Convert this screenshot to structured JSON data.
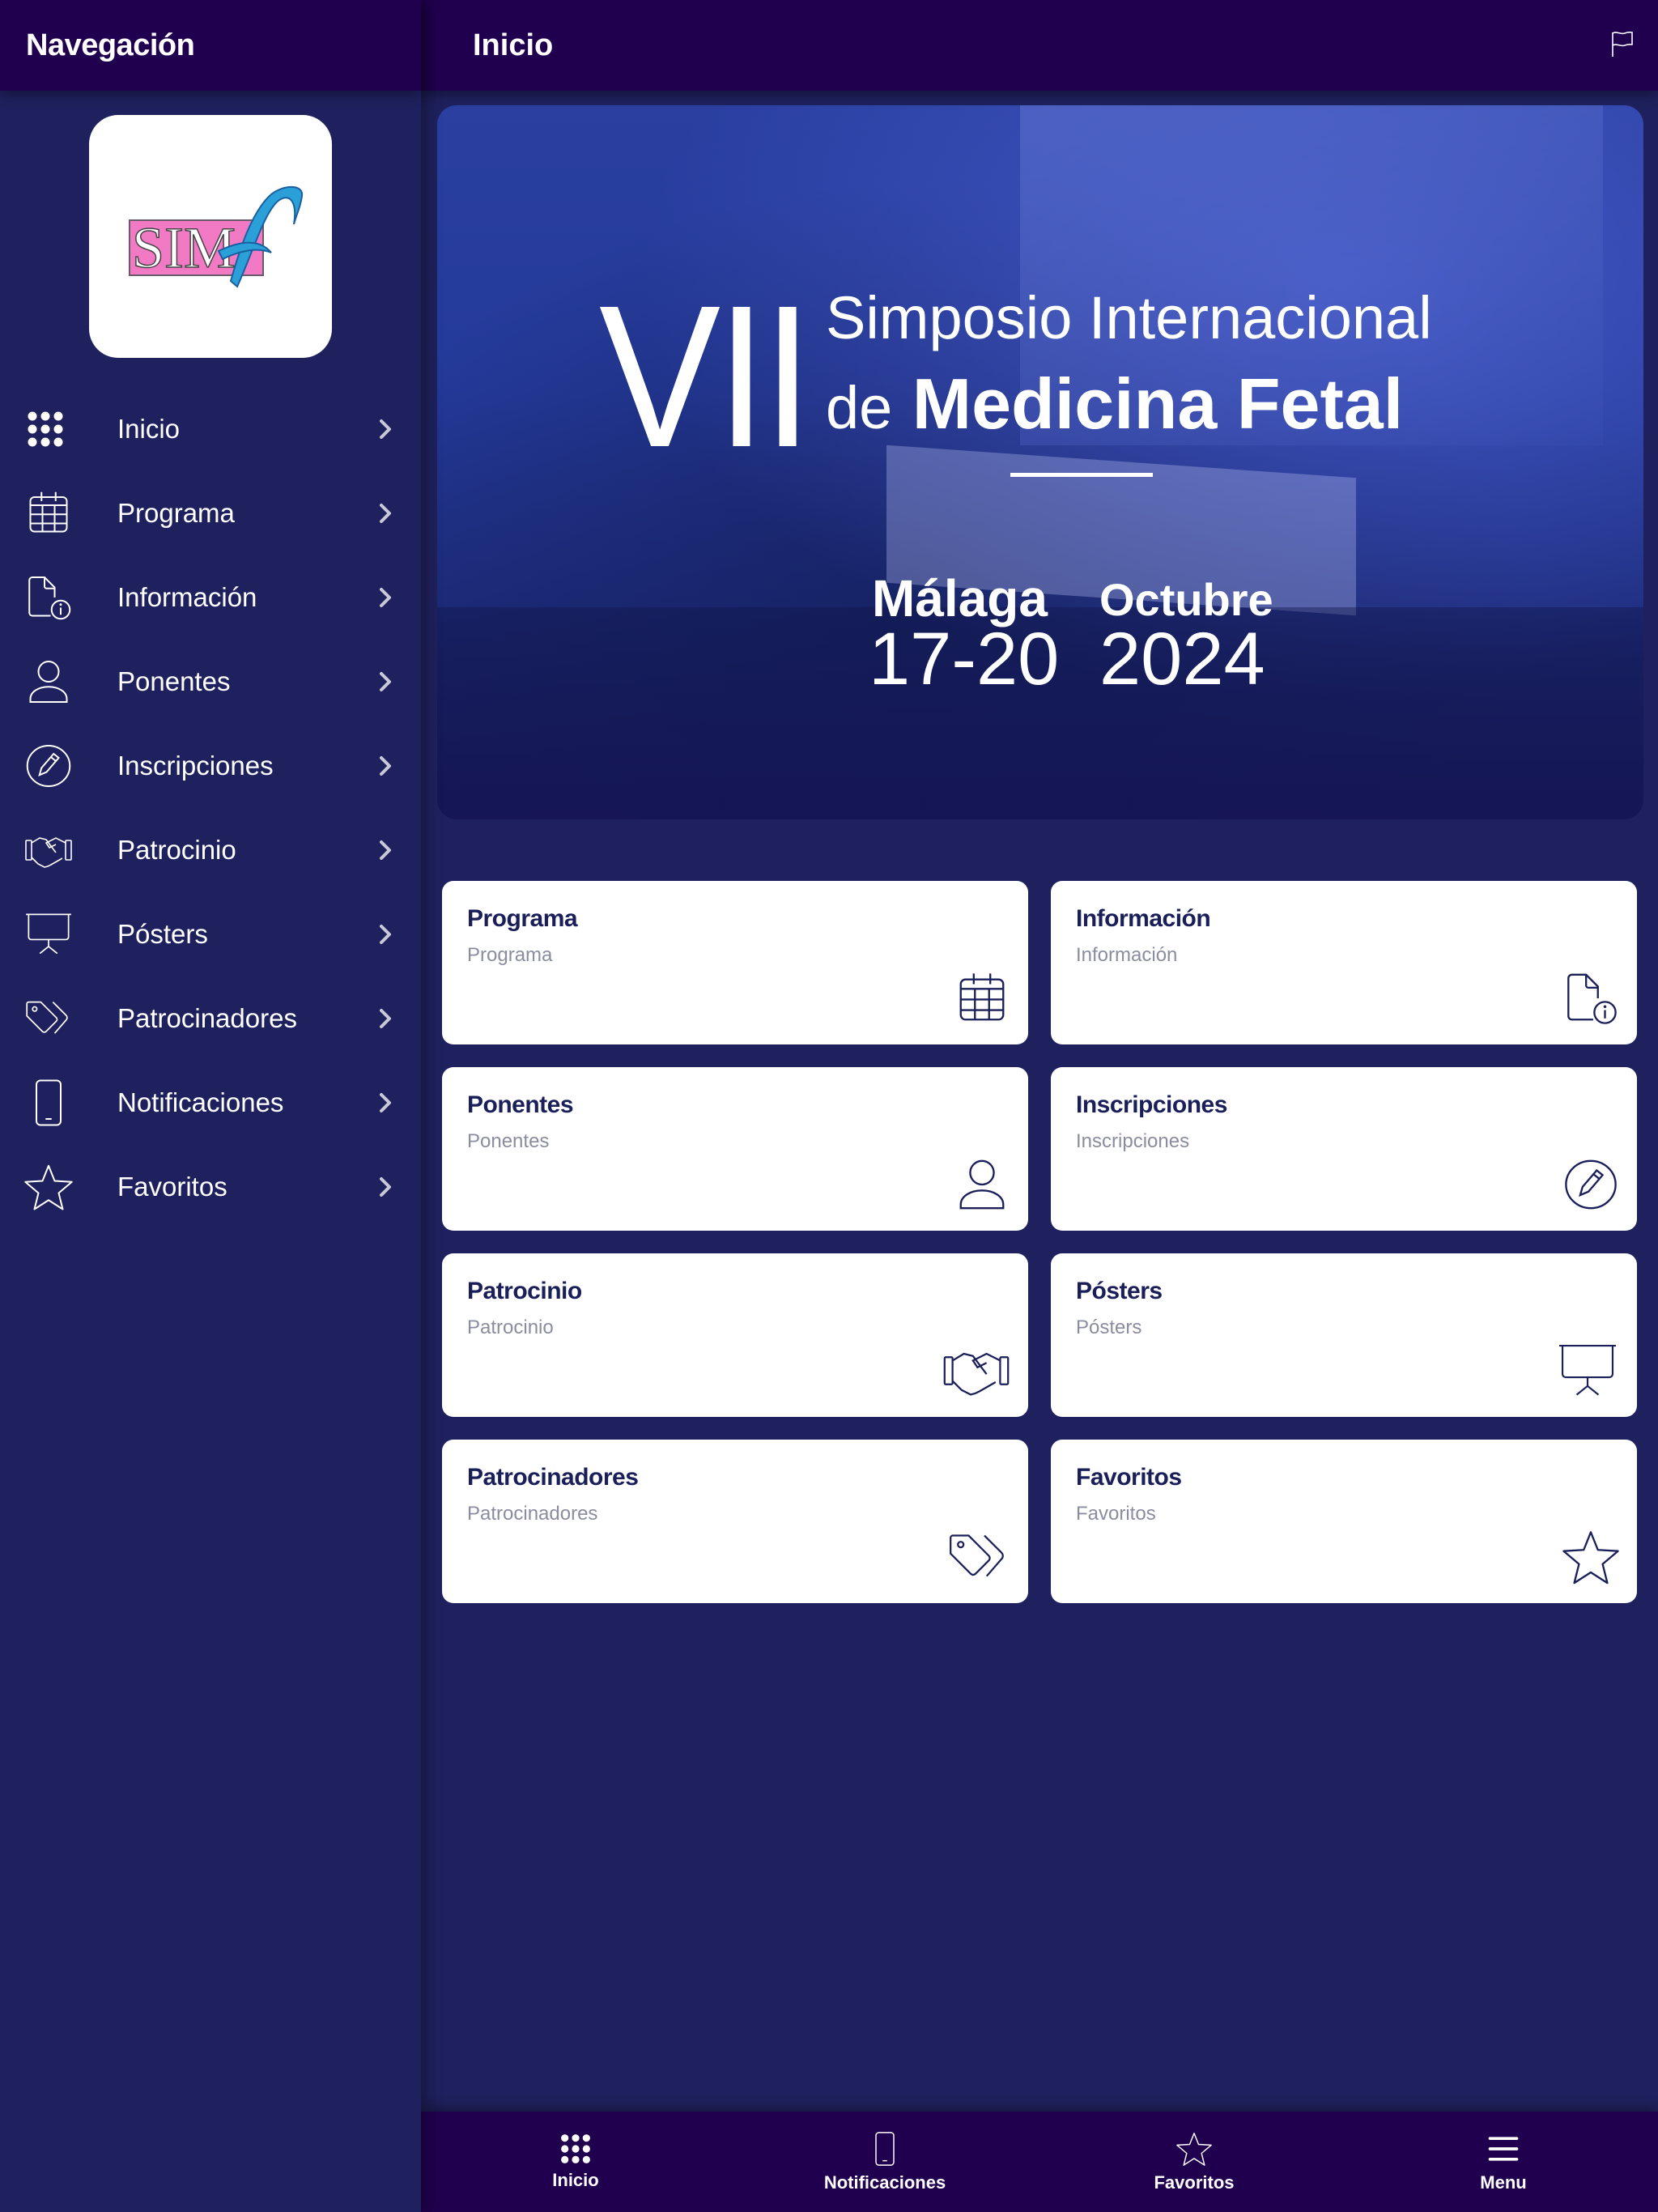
{
  "sidebar": {
    "title": "Navegación",
    "logo_text": "SIM",
    "logo_glyph": "f",
    "items": [
      {
        "label": "Inicio",
        "icon": "grid-dots-icon"
      },
      {
        "label": "Programa",
        "icon": "calendar-icon"
      },
      {
        "label": "Información",
        "icon": "document-info-icon"
      },
      {
        "label": "Ponentes",
        "icon": "person-icon"
      },
      {
        "label": "Inscripciones",
        "icon": "pencil-circle-icon"
      },
      {
        "label": "Patrocinio",
        "icon": "handshake-icon"
      },
      {
        "label": "Pósters",
        "icon": "presentation-board-icon"
      },
      {
        "label": "Patrocinadores",
        "icon": "tags-icon"
      },
      {
        "label": "Notificaciones",
        "icon": "phone-icon"
      },
      {
        "label": "Favoritos",
        "icon": "star-icon"
      }
    ]
  },
  "header": {
    "title": "Inicio",
    "flag_icon": "flag-icon"
  },
  "hero": {
    "edition": "VII",
    "line1": "Simposio Internacional",
    "line2_prefix": "de",
    "line2_main": "Medicina Fetal",
    "city": "Málaga",
    "dates": "17-20",
    "month": "Octubre",
    "year": "2024"
  },
  "cards": [
    {
      "title": "Programa",
      "subtitle": "Programa",
      "icon": "calendar-icon"
    },
    {
      "title": "Información",
      "subtitle": "Información",
      "icon": "document-info-icon"
    },
    {
      "title": "Ponentes",
      "subtitle": "Ponentes",
      "icon": "person-icon"
    },
    {
      "title": "Inscripciones",
      "subtitle": "Inscripciones",
      "icon": "pencil-circle-icon"
    },
    {
      "title": "Patrocinio",
      "subtitle": "Patrocinio",
      "icon": "handshake-icon"
    },
    {
      "title": "Pósters",
      "subtitle": "Pósters",
      "icon": "presentation-board-icon"
    },
    {
      "title": "Patrocinadores",
      "subtitle": "Patrocinadores",
      "icon": "tags-icon"
    },
    {
      "title": "Favoritos",
      "subtitle": "Favoritos",
      "icon": "star-icon"
    }
  ],
  "tabbar": [
    {
      "label": "Inicio",
      "icon": "grid-dots-icon"
    },
    {
      "label": "Notificaciones",
      "icon": "phone-icon"
    },
    {
      "label": "Favoritos",
      "icon": "star-icon"
    },
    {
      "label": "Menu",
      "icon": "hamburger-icon"
    }
  ],
  "colors": {
    "header_bg": "#20004e",
    "background": "#1f215e",
    "card_title": "#1a1f5a",
    "card_subtitle": "#8a8ca0",
    "logo_pink": "#f27ac4",
    "logo_blue": "#2a9fd8"
  }
}
